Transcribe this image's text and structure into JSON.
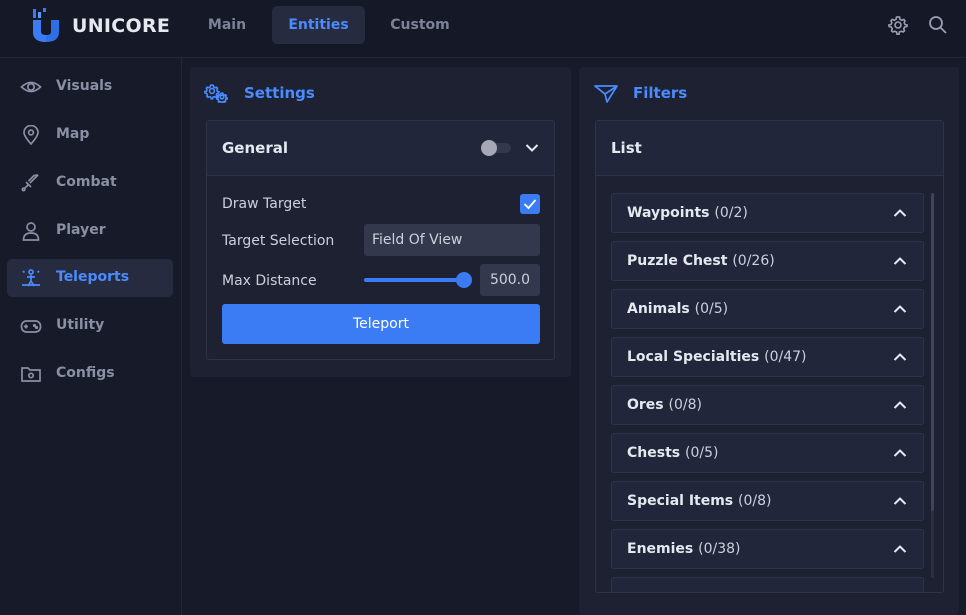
{
  "app": {
    "brand": "UNICORE"
  },
  "header": {
    "tabs": [
      {
        "label": "Main"
      },
      {
        "label": "Entities"
      },
      {
        "label": "Custom"
      }
    ],
    "active_tab": "Entities"
  },
  "sidebar": {
    "items": [
      {
        "label": "Visuals",
        "icon": "eye-icon"
      },
      {
        "label": "Map",
        "icon": "map-pin-icon"
      },
      {
        "label": "Combat",
        "icon": "sword-icon"
      },
      {
        "label": "Player",
        "icon": "user-icon"
      },
      {
        "label": "Teleports",
        "icon": "teleport-icon"
      },
      {
        "label": "Utility",
        "icon": "gamepad-icon"
      },
      {
        "label": "Configs",
        "icon": "folder-gear-icon"
      }
    ],
    "active_item": "Teleports"
  },
  "settings": {
    "title": "Settings",
    "general": {
      "title": "General",
      "toggle_on": false,
      "draw_target_label": "Draw Target",
      "draw_target_checked": true,
      "target_selection_label": "Target Selection",
      "target_selection_value": "Field Of View",
      "max_distance_label": "Max Distance",
      "max_distance_value": "500.0",
      "max_distance_fraction": 1.0,
      "teleport_button": "Teleport"
    }
  },
  "filters": {
    "title": "Filters",
    "list_title": "List",
    "items": [
      {
        "name": "Waypoints",
        "count": "(0/2)"
      },
      {
        "name": "Puzzle Chest",
        "count": "(0/26)"
      },
      {
        "name": "Animals",
        "count": "(0/5)"
      },
      {
        "name": "Local Specialties",
        "count": "(0/47)"
      },
      {
        "name": "Ores",
        "count": "(0/8)"
      },
      {
        "name": "Chests",
        "count": "(0/5)"
      },
      {
        "name": "Special Items",
        "count": "(0/8)"
      },
      {
        "name": "Enemies",
        "count": "(0/38)"
      }
    ]
  },
  "colors": {
    "accent": "#3b7cf4",
    "accent_text": "#4a8bff",
    "background": "#171a28",
    "panel": "#1d2132"
  }
}
